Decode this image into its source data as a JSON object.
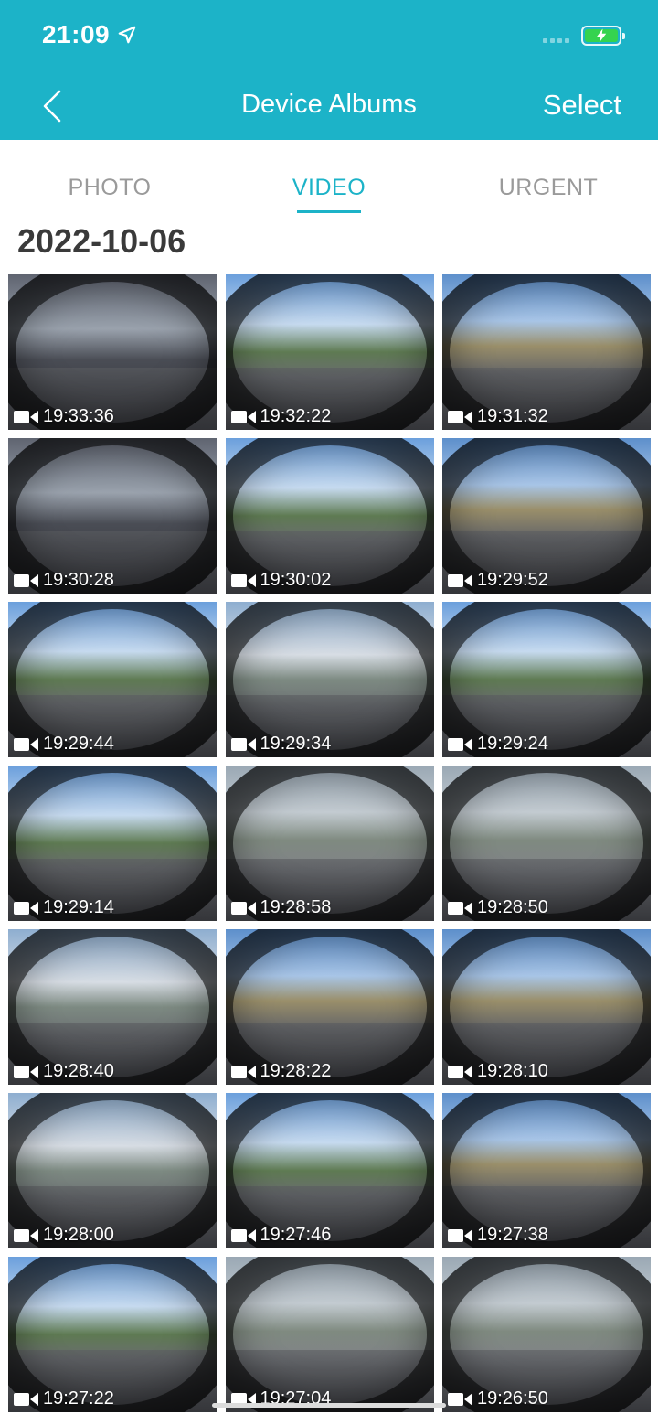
{
  "status_bar": {
    "time": "21:09"
  },
  "nav": {
    "title": "Device Albums",
    "select_label": "Select"
  },
  "tabs": [
    {
      "label": "PHOTO",
      "active": false
    },
    {
      "label": "VIDEO",
      "active": true
    },
    {
      "label": "URGENT",
      "active": false
    }
  ],
  "colors": {
    "accent": "#1cb3c8",
    "battery": "#35d34f"
  },
  "album": {
    "date": "2022-10-06",
    "videos": [
      {
        "time": "19:33:36"
      },
      {
        "time": "19:32:22"
      },
      {
        "time": "19:31:32"
      },
      {
        "time": "19:30:28"
      },
      {
        "time": "19:30:02"
      },
      {
        "time": "19:29:52"
      },
      {
        "time": "19:29:44"
      },
      {
        "time": "19:29:34"
      },
      {
        "time": "19:29:24"
      },
      {
        "time": "19:29:14"
      },
      {
        "time": "19:28:58"
      },
      {
        "time": "19:28:50"
      },
      {
        "time": "19:28:40"
      },
      {
        "time": "19:28:22"
      },
      {
        "time": "19:28:10"
      },
      {
        "time": "19:28:00"
      },
      {
        "time": "19:27:46"
      },
      {
        "time": "19:27:38"
      },
      {
        "time": "19:27:22"
      },
      {
        "time": "19:27:04"
      },
      {
        "time": "19:26:50"
      }
    ]
  }
}
